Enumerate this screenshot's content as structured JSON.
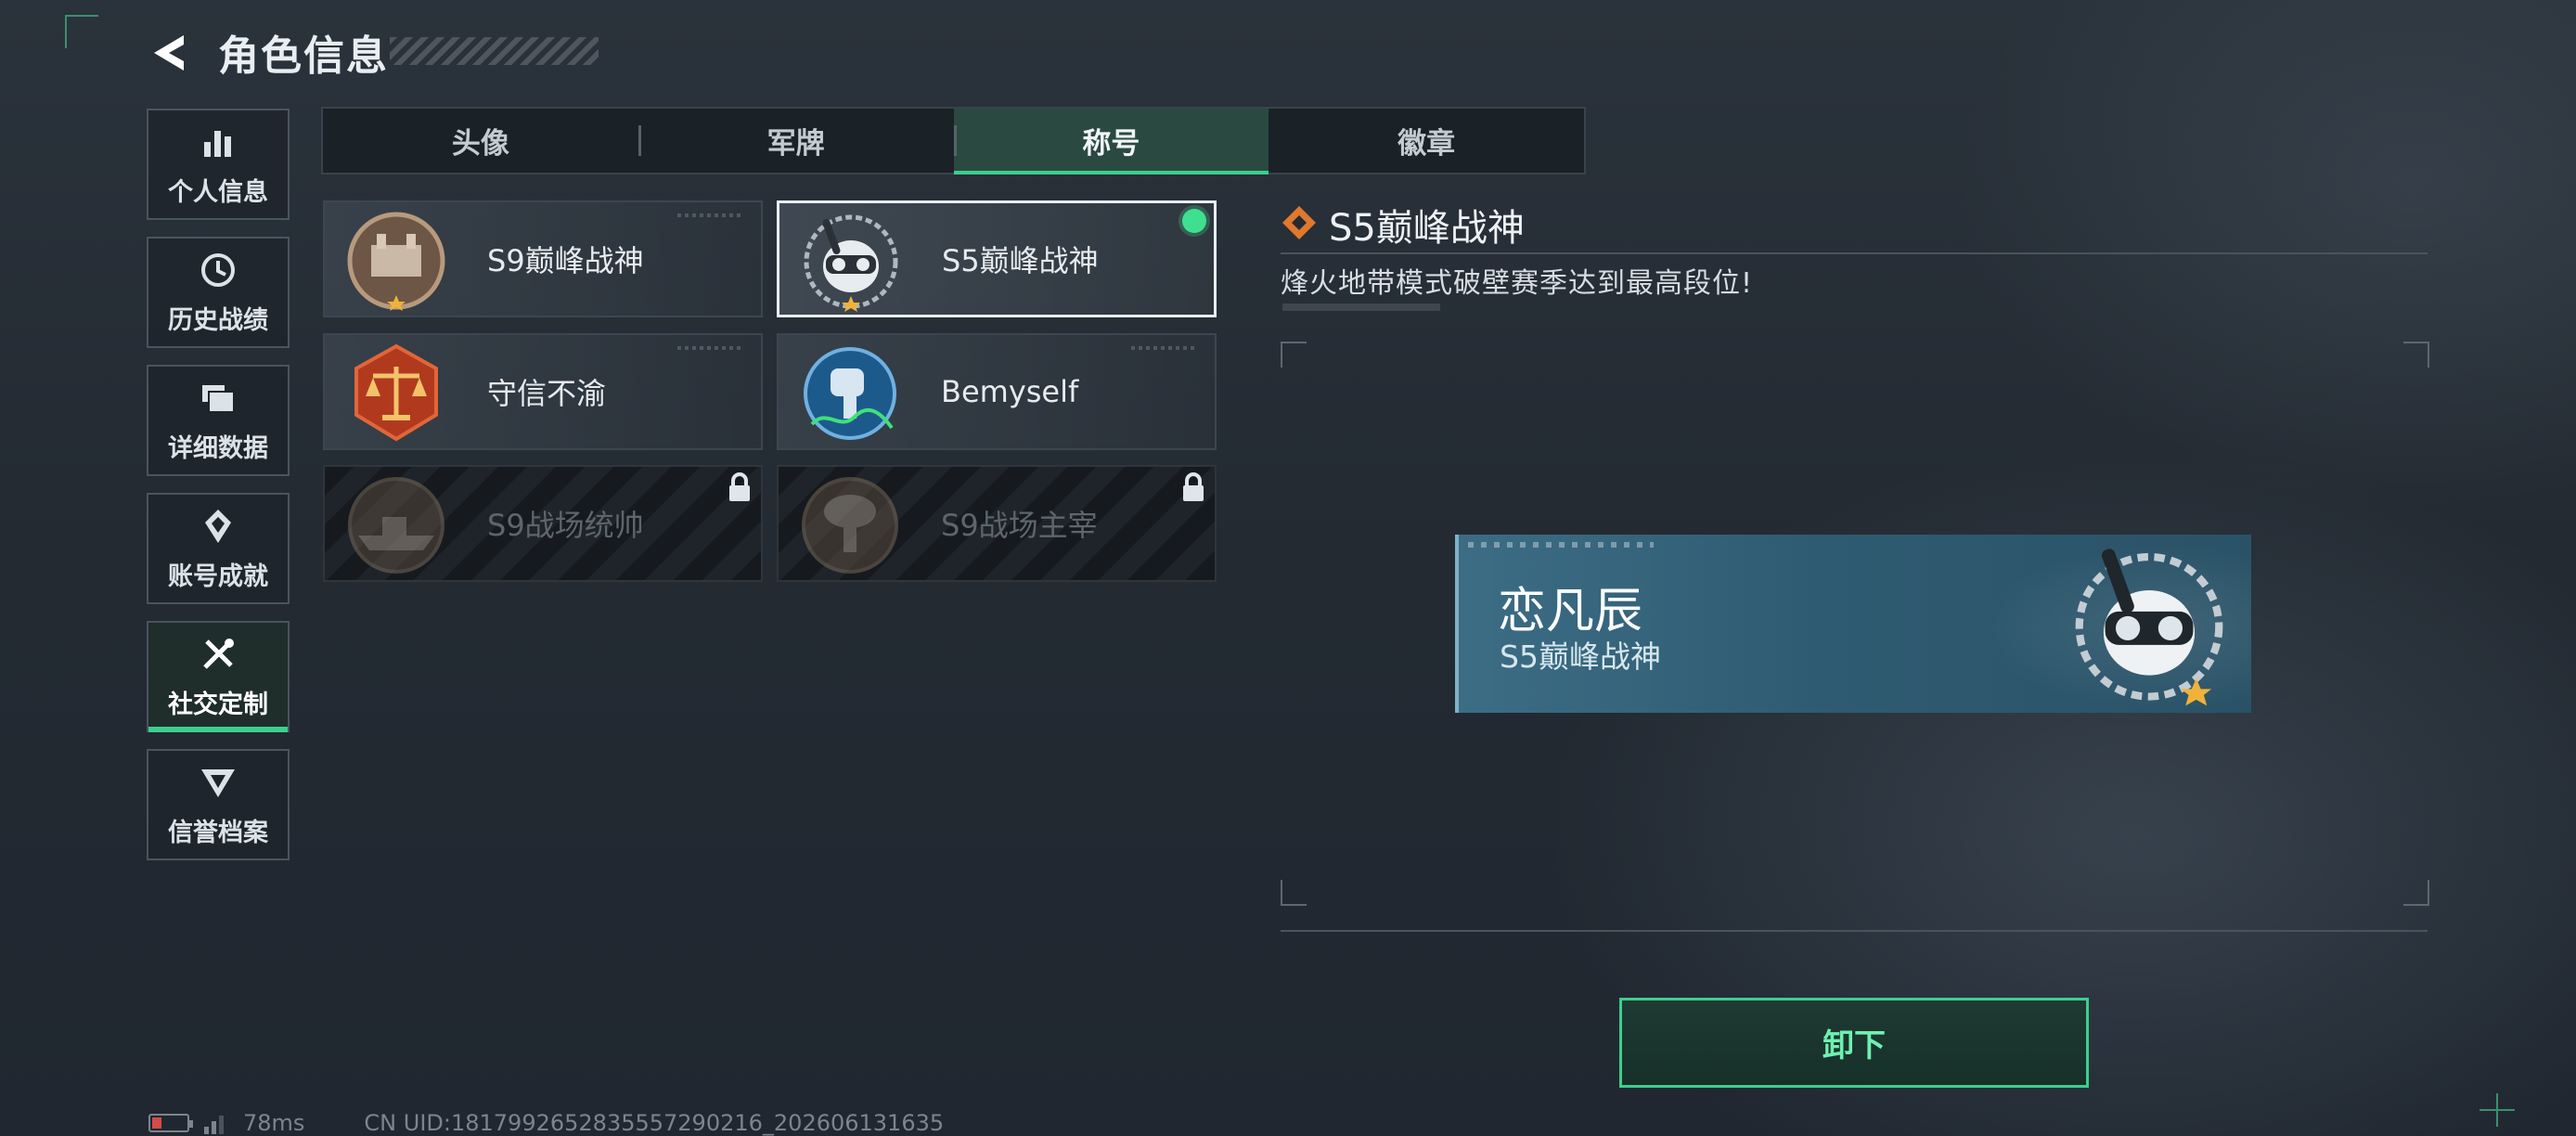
{
  "header": {
    "title": "角色信息"
  },
  "sidebar": {
    "items": [
      {
        "label": "个人信息",
        "icon": "bar-chart-icon"
      },
      {
        "label": "历史战绩",
        "icon": "history-icon"
      },
      {
        "label": "详细数据",
        "icon": "folder-icon"
      },
      {
        "label": "账号成就",
        "icon": "achievement-icon"
      },
      {
        "label": "社交定制",
        "icon": "tools-icon",
        "active": true
      },
      {
        "label": "信誉档案",
        "icon": "credit-icon"
      }
    ]
  },
  "tabs": [
    {
      "label": "头像"
    },
    {
      "label": "军牌"
    },
    {
      "label": "称号",
      "active": true
    },
    {
      "label": "徽章"
    }
  ],
  "titles": [
    {
      "name": "S9巅峰战神",
      "badge": "bronze-fort-badge-icon",
      "locked": false
    },
    {
      "name": "S5巅峰战神",
      "badge": "skull-snorkel-badge-icon",
      "locked": false,
      "selected": true,
      "equipped": true
    },
    {
      "name": "守信不渝",
      "badge": "scales-badge-icon",
      "locked": false
    },
    {
      "name": "Bemyself",
      "badge": "bemyself-signature-badge-icon",
      "locked": false
    },
    {
      "name": "S9战场统帅",
      "badge": "warship-badge-icon",
      "locked": true
    },
    {
      "name": "S9战场主宰",
      "badge": "mushroom-cloud-badge-icon",
      "locked": true
    }
  ],
  "detail": {
    "title": "S5巅峰战神",
    "description": "烽火地带模式破壁赛季达到最高段位!",
    "preview": {
      "player_name": "恋凡辰",
      "title": "S5巅峰战神"
    },
    "unequip_label": "卸下"
  },
  "status_bar": {
    "ping": "78ms",
    "uid": "CN UID:1817992652835557290216_202606131635"
  },
  "colors": {
    "accent": "#3ccf8e",
    "selected_border": "#e8eef2",
    "preview_bg": "#2f5b72"
  }
}
